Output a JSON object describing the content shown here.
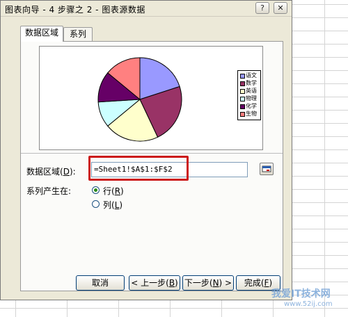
{
  "window": {
    "title": "图表向导 - 4 步骤之 2 - 图表源数据",
    "help_glyph": "?",
    "close_glyph": "✕"
  },
  "tabs": [
    {
      "label": "数据区域",
      "active": true
    },
    {
      "label": "系列",
      "active": false
    }
  ],
  "chart_data": {
    "type": "pie",
    "categories": [
      "语文",
      "数学",
      "英语",
      "物理",
      "化学",
      "生物"
    ],
    "values": [
      20,
      23,
      21,
      10,
      12,
      14
    ],
    "colors": [
      "#9999ff",
      "#993366",
      "#ffffcc",
      "#ccffff",
      "#660066",
      "#ff8080"
    ],
    "title": "",
    "legend_position": "right"
  },
  "data_range": {
    "label": "数据区域(",
    "hotkey": "D",
    "label_suffix": "):",
    "value": "=Sheet1!$A$1:$F$2"
  },
  "series_in": {
    "label": "系列产生在:",
    "options": [
      {
        "text": "行(",
        "hotkey": "R",
        "suffix": ")",
        "checked": true
      },
      {
        "text": "列(",
        "hotkey": "L",
        "suffix": ")",
        "checked": false
      }
    ]
  },
  "buttons": {
    "cancel": "取消",
    "back_prefix": "< 上一步(",
    "back_hotkey": "B",
    "back_suffix": ")",
    "next_prefix": "下一步(",
    "next_hotkey": "N",
    "next_suffix": ") >",
    "finish_prefix": "完成(",
    "finish_hotkey": "F",
    "finish_suffix": ")"
  },
  "watermark": {
    "text1": "我爱IT技术网",
    "text2": "www.52ij.com"
  },
  "colors": {
    "highlight": "#cc1a1a",
    "dialog_bg": "#ece9d8"
  }
}
